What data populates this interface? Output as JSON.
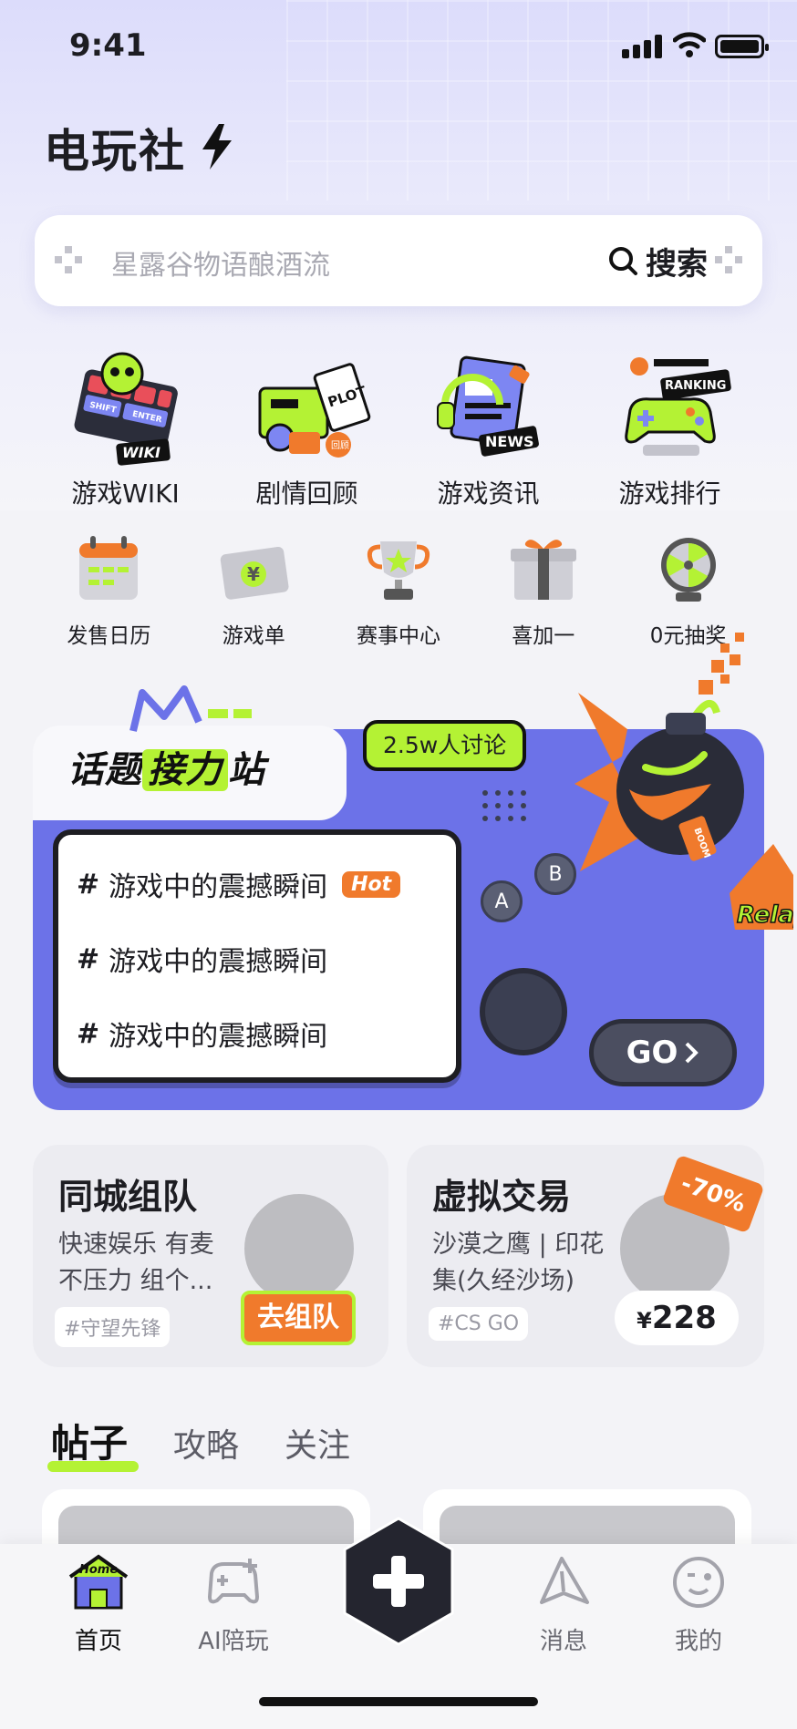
{
  "status_bar": {
    "time": "9:41"
  },
  "app": {
    "title": "电玩社"
  },
  "search": {
    "placeholder": "星露谷物语酿酒流",
    "button_label": "搜索"
  },
  "main_grid": [
    {
      "label": "游戏WIKI",
      "icon": "wiki-icon",
      "icon_text": [
        "SHIFT",
        "ENTER",
        "WIKI"
      ]
    },
    {
      "label": "剧情回顾",
      "icon": "plot-icon",
      "icon_text": [
        "PLOT",
        "回顾"
      ]
    },
    {
      "label": "游戏资讯",
      "icon": "news-icon",
      "icon_text": [
        "NEWS"
      ]
    },
    {
      "label": "游戏排行",
      "icon": "ranking-icon",
      "icon_text": [
        "RANKING"
      ]
    }
  ],
  "sub_grid": [
    {
      "label": "发售日历",
      "icon": "calendar-icon"
    },
    {
      "label": "游戏单",
      "icon": "ticket-icon",
      "icon_text": "¥"
    },
    {
      "label": "赛事中心",
      "icon": "trophy-icon"
    },
    {
      "label": "喜加一",
      "icon": "gift-icon"
    },
    {
      "label": "0元抽奖",
      "icon": "lottery-wheel-icon"
    }
  ],
  "topic_relay": {
    "title_prefix": "话题",
    "title_highlight": "接力",
    "title_suffix": "站",
    "discussion_count": "2.5w人讨论",
    "topics": [
      {
        "text": "游戏中的震撼瞬间",
        "badge": "Hot"
      },
      {
        "text": "游戏中的震撼瞬间",
        "badge": ""
      },
      {
        "text": "游戏中的震撼瞬间",
        "badge": ""
      }
    ],
    "hash": "#",
    "btn_a": "A",
    "btn_b": "B",
    "go_label": "GO",
    "deco_text": [
      "BOOM",
      "Relay"
    ]
  },
  "team_card": {
    "title": "同城组队",
    "desc": "快速娱乐 有麦不压力 组个...",
    "tag": "#守望先锋",
    "button": "去组队"
  },
  "trade_card": {
    "title": "虚拟交易",
    "desc": "沙漠之鹰 | 印花集(久经沙场)",
    "tag": "#CS GO",
    "discount": "-70%",
    "price_currency": "¥",
    "price": "228"
  },
  "feed_tabs": [
    "帖子",
    "攻略",
    "关注"
  ],
  "tab_bar": [
    {
      "label": "首页",
      "icon": "home-icon",
      "icon_text": "Home",
      "active": true
    },
    {
      "label": "AI陪玩",
      "icon": "gamepad-plus-icon",
      "active": false
    },
    {
      "label": "消息",
      "icon": "message-icon",
      "active": false
    },
    {
      "label": "我的",
      "icon": "profile-face-icon",
      "active": false
    }
  ],
  "colors": {
    "accent_green": "#b4f234",
    "accent_orange": "#f07a2c",
    "relay_purple": "#6c72e8",
    "dark": "#2a2c38"
  }
}
